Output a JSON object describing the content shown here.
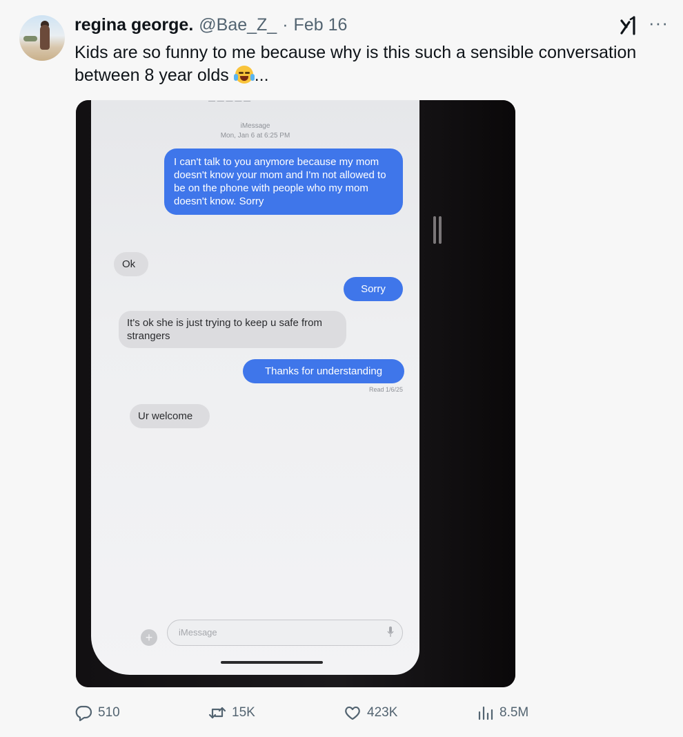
{
  "author": {
    "display_name": "regina george.",
    "handle": "@Bae_Z_",
    "separator": "·",
    "date": "Feb 16"
  },
  "post": {
    "text_line1": "Kids are so funny to me because why is this such a sensible conversation",
    "text_line2": "between 8 year olds",
    "text_suffix": "...",
    "emoji": "face-with-tears-of-joy"
  },
  "header_icons": {
    "grok": "grok-icon",
    "more": "···"
  },
  "media": {
    "service_label": "iMessage",
    "timestamp": "Mon, Jan 6 at 6:25 PM",
    "messages": [
      {
        "direction": "sent",
        "text": "I can't talk to you anymore because my mom doesn't know your mom and I'm not allowed to be on the phone with people who my mom doesn't know. Sorry"
      },
      {
        "direction": "received",
        "text": "Ok"
      },
      {
        "direction": "sent",
        "text": "Sorry"
      },
      {
        "direction": "received",
        "text": "It's ok she is just trying to keep u safe from strangers"
      },
      {
        "direction": "sent",
        "text": "Thanks for understanding"
      },
      {
        "direction": "received",
        "text": "Ur welcome"
      }
    ],
    "read_receipt": "Read 1/6/25",
    "compose_placeholder": "iMessage",
    "plus_label": "+"
  },
  "actions": {
    "replies": "510",
    "reposts": "15K",
    "likes": "423K",
    "views": "8.5M"
  },
  "colors": {
    "background": "#f7f7f7",
    "sent_bubble": "#3f76ea",
    "received_bubble": "#dcdcdf",
    "secondary_text": "#536471"
  }
}
